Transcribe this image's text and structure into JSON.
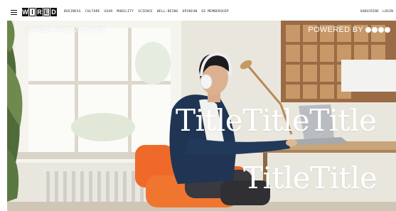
{
  "nav": {
    "menu_icon": "hamburger-menu-icon",
    "logo_letters": [
      "W",
      "I",
      "R",
      "E",
      "D"
    ],
    "links": [
      "BUSINESS",
      "CULTURE",
      "GEAR",
      "MOBILITY",
      "SCIENCE",
      "WELL-BEING",
      "OPINION",
      "OZ MEMBERSHIP"
    ],
    "subscribe": "SUBSCRIBE",
    "login": "LOGIN"
  },
  "hero": {
    "promo_label": "WIRED PROMOTION",
    "powered_by": "POWERED BY",
    "sponsor_logo_icon": "four-dots-logo",
    "title_line_1": "TitleTitleTitle",
    "title_line_2": "TitleTitle",
    "image_subject": "hero-photo-man-with-headphones-using-laptop"
  },
  "colors": {
    "nav_background": "#ffffff",
    "nav_text": "#222222",
    "logo_fill": "#111111",
    "overlay_text": "#ffffff"
  }
}
